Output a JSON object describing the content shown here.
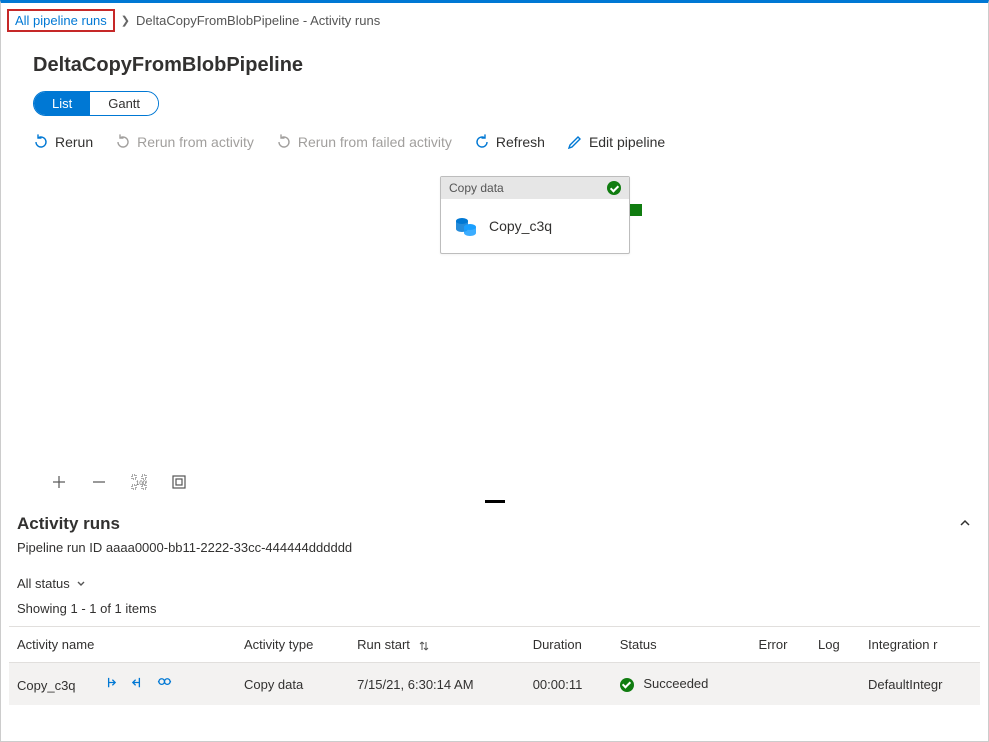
{
  "breadcrumb": {
    "link": "All pipeline runs",
    "current": "DeltaCopyFromBlobPipeline - Activity runs"
  },
  "title": "DeltaCopyFromBlobPipeline",
  "view_toggle": {
    "list": "List",
    "gantt": "Gantt"
  },
  "toolbar": {
    "rerun": "Rerun",
    "rerun_activity": "Rerun from activity",
    "rerun_failed": "Rerun from failed activity",
    "refresh": "Refresh",
    "edit": "Edit pipeline"
  },
  "node": {
    "header": "Copy data",
    "name": "Copy_c3q"
  },
  "lower": {
    "heading": "Activity runs",
    "run_id_label": "Pipeline run ID",
    "run_id_value": "aaaa0000-bb11-2222-33cc-444444dddddd",
    "status_filter": "All status",
    "count_text": "Showing 1 - 1 of 1 items"
  },
  "columns": {
    "activity_name": "Activity name",
    "activity_type": "Activity type",
    "run_start": "Run start",
    "duration": "Duration",
    "status": "Status",
    "error": "Error",
    "log": "Log",
    "integration": "Integration r"
  },
  "rows": [
    {
      "activity_name": "Copy_c3q",
      "activity_type": "Copy data",
      "run_start": "7/15/21, 6:30:14 AM",
      "duration": "00:00:11",
      "status": "Succeeded",
      "error": "",
      "log": "",
      "integration": "DefaultIntegr"
    }
  ]
}
